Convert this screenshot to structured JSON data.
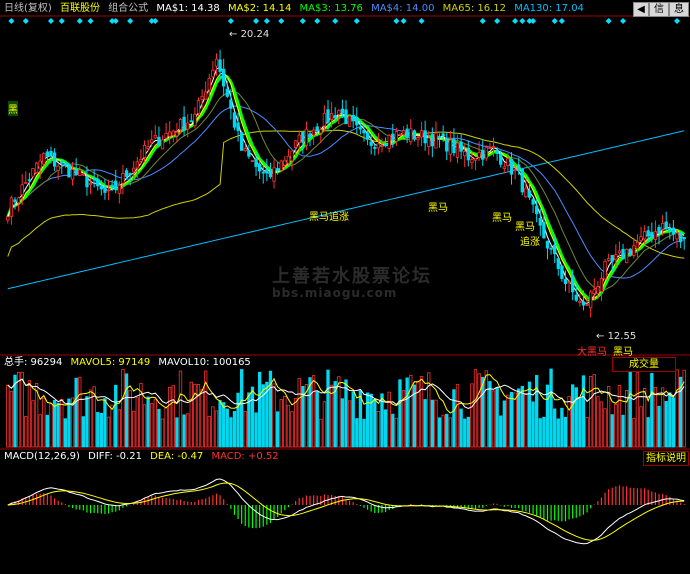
{
  "header": {
    "period": "日线(复权)",
    "stock": "百联股份",
    "formula": "组合公式",
    "ma1": "MA$1: 14.38",
    "ma2": "MA$2: 14.14",
    "ma3": "MA$3: 13.76",
    "ma4": "MA$4: 14.00",
    "ma65": "MA65: 16.12",
    "ma130": "MA130: 17.04"
  },
  "buttons": {
    "prev": "◀",
    "info": "信",
    "next": "息"
  },
  "vol_header": {
    "total": "总手: 96294",
    "mavol5": "MAVOL5: 97149",
    "mavol10": "MAVOL10: 100165",
    "button": "成交量"
  },
  "macd_header": {
    "name": "MACD(12,26,9)",
    "diff": "DIFF: -0.21",
    "dea": "DEA: -0.47",
    "macd": "MACD: +0.52",
    "button": "指标说明"
  },
  "annotations": {
    "high": "20.24",
    "low": "12.55",
    "a1": "黑马",
    "a1b": "追涨",
    "a2": "黑马",
    "a3": "黑马",
    "a4": "黑马",
    "a5": "追涨",
    "a6": "大黑马",
    "a7": "黑马",
    "left_mark": "黑"
  },
  "watermark": {
    "line1": "上善若水股票论坛",
    "line2": "bbs.miaogu.com"
  },
  "colors": {
    "up": "#ff3030",
    "down": "#00d8f0",
    "ma1": "#ffffff",
    "ma2": "#ffff00",
    "ma3": "#00ff00",
    "ma4": "#4a8cff",
    "ma65": "#d0d000",
    "ma130": "#00c0ff",
    "diff": "#ffffff",
    "dea": "#ffff00",
    "macd_pos": "#ff3030",
    "macd_neg": "#00ff00"
  },
  "chart_data": {
    "type": "candlestick",
    "high_price": 20.24,
    "low_price": 12.55,
    "price_range": [
      11.5,
      21.2
    ],
    "key_points": [
      {
        "i": 0,
        "p": 15.6
      },
      {
        "i": 10,
        "p": 17.2
      },
      {
        "i": 20,
        "p": 16.6
      },
      {
        "i": 28,
        "p": 16.0
      },
      {
        "i": 40,
        "p": 17.6
      },
      {
        "i": 52,
        "p": 18.4
      },
      {
        "i": 58,
        "p": 20.2
      },
      {
        "i": 65,
        "p": 17.4
      },
      {
        "i": 72,
        "p": 16.5
      },
      {
        "i": 82,
        "p": 17.8
      },
      {
        "i": 92,
        "p": 18.6
      },
      {
        "i": 100,
        "p": 17.6
      },
      {
        "i": 110,
        "p": 17.9
      },
      {
        "i": 120,
        "p": 17.7
      },
      {
        "i": 128,
        "p": 17.2
      },
      {
        "i": 135,
        "p": 17.4
      },
      {
        "i": 142,
        "p": 16.6
      },
      {
        "i": 148,
        "p": 15.0
      },
      {
        "i": 155,
        "p": 13.4
      },
      {
        "i": 160,
        "p": 12.6
      },
      {
        "i": 166,
        "p": 13.8
      },
      {
        "i": 174,
        "p": 14.5
      },
      {
        "i": 182,
        "p": 15.1
      },
      {
        "i": 188,
        "p": 14.6
      }
    ],
    "bars": 189
  }
}
